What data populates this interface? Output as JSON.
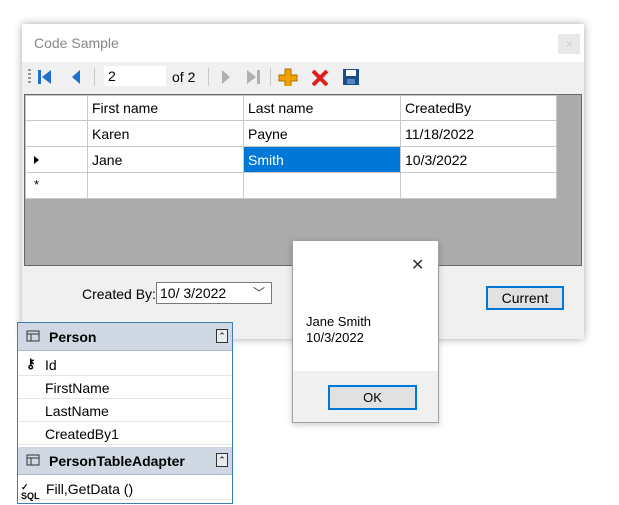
{
  "window": {
    "title": "Code Sample",
    "close_glyph": "×"
  },
  "navigator": {
    "position": "2",
    "count_label": "of 2",
    "icons": [
      "move-first-icon",
      "move-previous-icon",
      "move-next-icon",
      "move-last-icon",
      "add-new-icon",
      "delete-icon",
      "save-icon"
    ],
    "colors": {
      "nav_blue": "#1e6fd0",
      "add_orange": "#f0a000",
      "delete_red": "#e02020",
      "save_blue": "#1a4b8a"
    }
  },
  "grid": {
    "columns": [
      "First name",
      "Last name",
      "CreatedBy"
    ],
    "rows": [
      {
        "first": "Karen",
        "last": "Payne",
        "created": "11/18/2022"
      },
      {
        "first": "Jane",
        "last": "Smith",
        "created": "10/3/2022"
      }
    ],
    "new_row_marker": "*",
    "selection_color": "#0078d7"
  },
  "form": {
    "created_by_label": "Created By:",
    "created_by_value": "10/  3/2022",
    "current_button": "Current"
  },
  "message_box": {
    "line1": "Jane Smith",
    "line2": "10/3/2022",
    "ok_label": "OK",
    "close_glyph": "✕"
  },
  "designer": {
    "entity": {
      "name": "Person",
      "fields": [
        "Id",
        "FirstName",
        "LastName",
        "CreatedBy1"
      ]
    },
    "adapter": {
      "name": "PersonTableAdapter",
      "methods": "Fill,GetData ()"
    },
    "collapse_glyph": "⌃"
  }
}
